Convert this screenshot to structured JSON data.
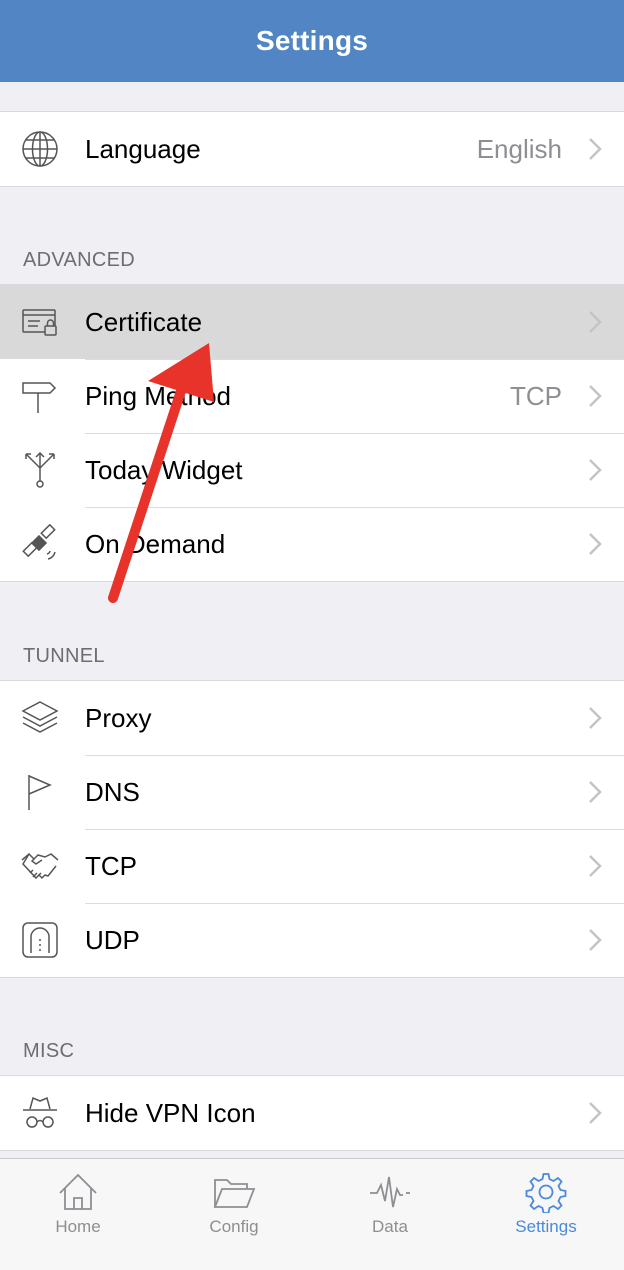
{
  "navbar": {
    "title": "Settings"
  },
  "general": {
    "language": {
      "label": "Language",
      "value": "English",
      "icon": "globe-icon"
    }
  },
  "advanced": {
    "header": "ADVANCED",
    "items": [
      {
        "label": "Certificate",
        "value": "",
        "icon": "certificate-icon",
        "highlighted": true
      },
      {
        "label": "Ping Method",
        "value": "TCP",
        "icon": "signpost-icon"
      },
      {
        "label": "Today Widget",
        "value": "",
        "icon": "fork-icon"
      },
      {
        "label": "On Demand",
        "value": "",
        "icon": "satellite-icon"
      }
    ]
  },
  "tunnel": {
    "header": "TUNNEL",
    "items": [
      {
        "label": "Proxy",
        "icon": "layers-icon"
      },
      {
        "label": "DNS",
        "icon": "flag-icon"
      },
      {
        "label": "TCP",
        "icon": "handshake-icon"
      },
      {
        "label": "UDP",
        "icon": "tunnel-icon"
      }
    ]
  },
  "misc": {
    "header": "MISC",
    "items": [
      {
        "label": "Hide VPN Icon",
        "icon": "incognito-icon"
      }
    ]
  },
  "tabbar": {
    "items": [
      {
        "label": "Home",
        "icon": "home-icon",
        "active": false
      },
      {
        "label": "Config",
        "icon": "folder-icon",
        "active": false
      },
      {
        "label": "Data",
        "icon": "pulse-icon",
        "active": false
      },
      {
        "label": "Settings",
        "icon": "gear-icon",
        "active": true
      }
    ]
  },
  "colors": {
    "navbar": "#5185c4",
    "background": "#efeff4",
    "highlight": "#d9d9d9",
    "active_tab": "#4a89dc",
    "annotation_arrow": "#e8332a"
  }
}
